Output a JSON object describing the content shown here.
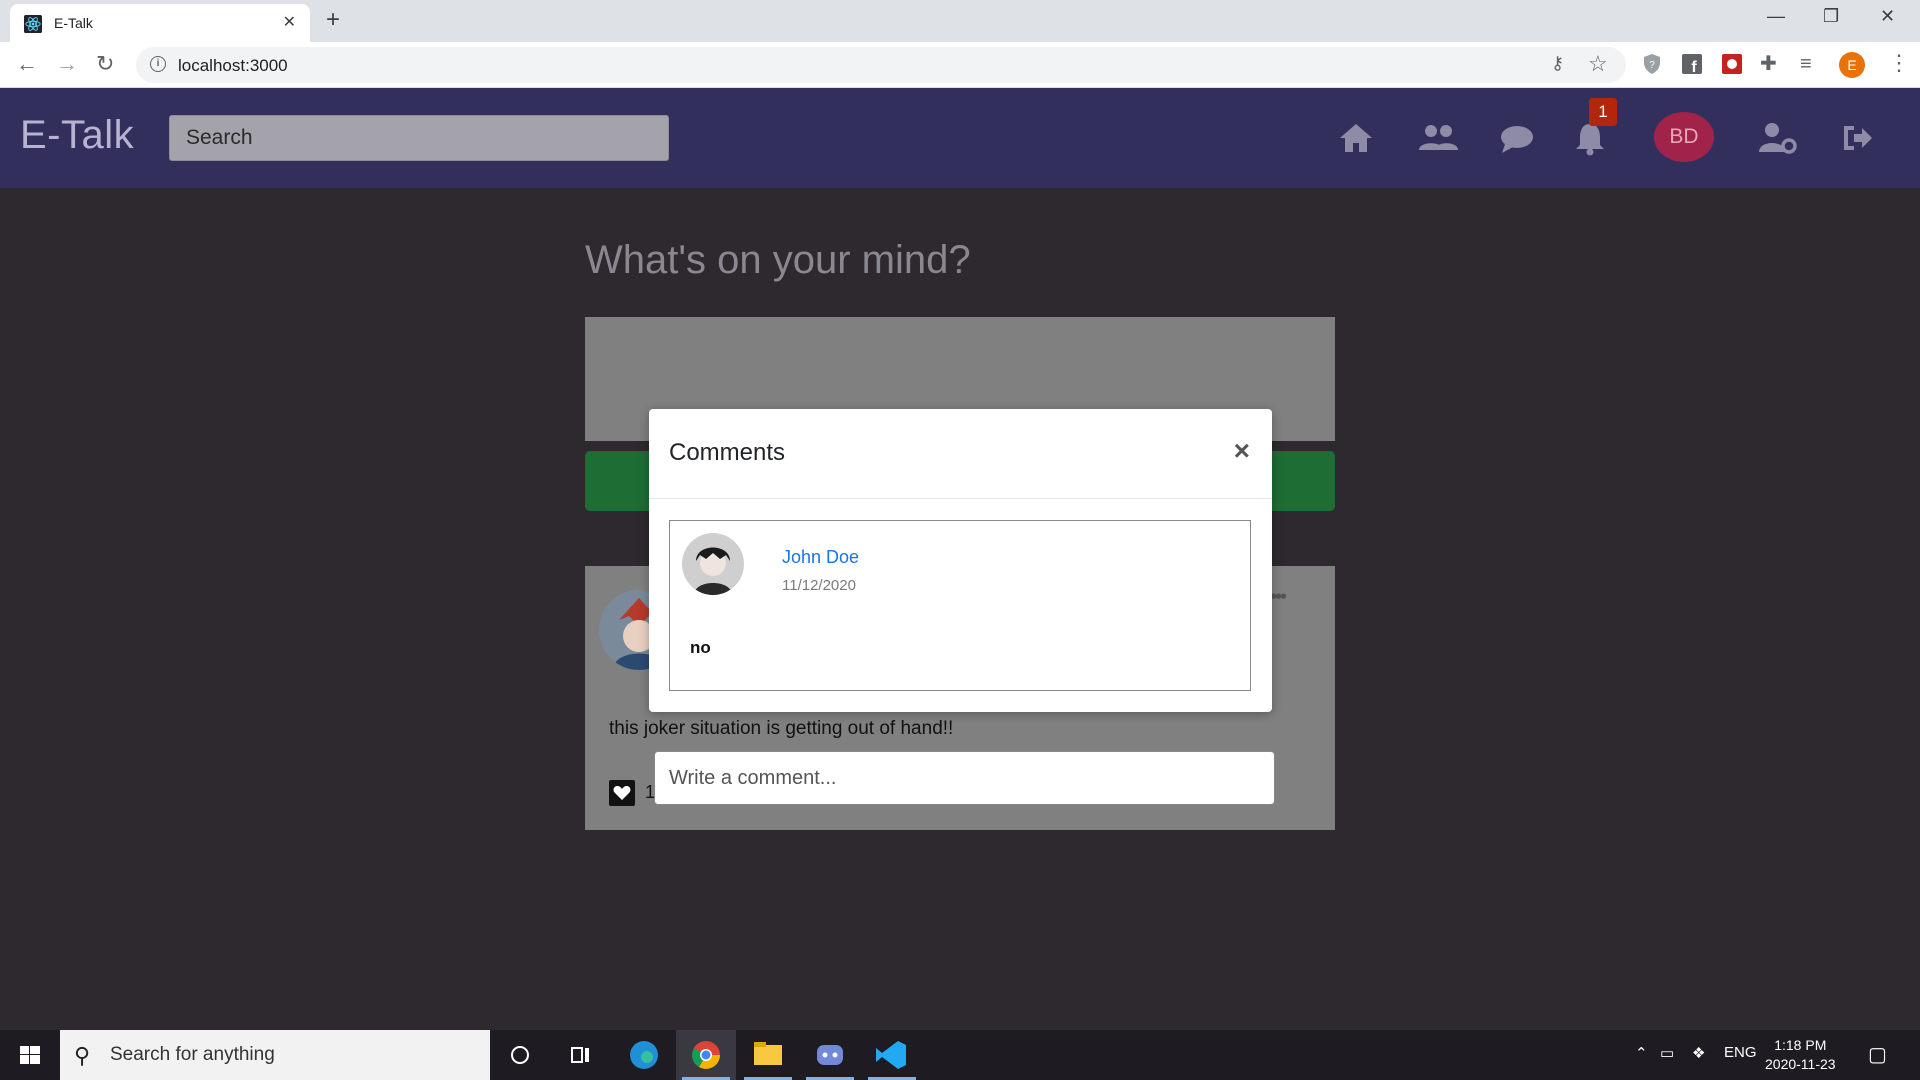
{
  "browser": {
    "tab_title": "E-Talk",
    "url": "localhost:3000",
    "profile_initial": "E"
  },
  "header": {
    "brand": "E-Talk",
    "search_placeholder": "Search",
    "notification_count": "1",
    "user_initials": "BD"
  },
  "feed": {
    "heading": "What's on your mind?",
    "post": {
      "text": "this joker situation is getting out of hand!!",
      "like_count": "1",
      "comment_placeholder": "Write a comment..."
    }
  },
  "modal": {
    "title": "Comments",
    "close_label": "×",
    "comment": {
      "author": "John Doe",
      "date": "11/12/2020",
      "text": "no"
    }
  },
  "taskbar": {
    "search_placeholder": "Search for anything",
    "language": "ENG",
    "time": "1:18 PM",
    "date": "2020-11-23"
  },
  "colors": {
    "header_bg": "#322f5d",
    "page_bg": "#2d292f",
    "post_button": "#1d6d35",
    "notification_badge": "#b2260d",
    "user_avatar": "#a2234a",
    "link_blue": "#1a73e8"
  }
}
